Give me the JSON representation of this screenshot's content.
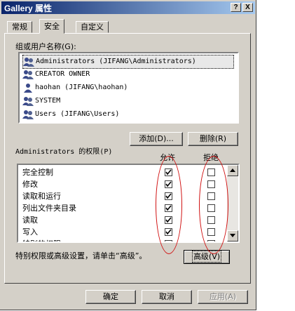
{
  "window": {
    "title": "Gallery 属性",
    "help_label": "?",
    "close_label": "X"
  },
  "tabs": [
    {
      "label": "常规",
      "active": false
    },
    {
      "label": "安全",
      "active": true
    },
    {
      "label": "自定义",
      "active": false
    }
  ],
  "users": {
    "label": "组或用户名称(G):",
    "items": [
      "Administrators (JIFANG\\Administrators)",
      "CREATOR OWNER",
      "haohan (JIFANG\\haohan)",
      "SYSTEM",
      "Users (JIFANG\\Users)"
    ],
    "add_label": "添加(D)...",
    "remove_label": "删除(R)"
  },
  "permissions": {
    "label": "Administrators 的权限(P)",
    "allow_header": "允许",
    "deny_header": "拒绝",
    "rows": [
      {
        "name": "完全控制",
        "allow": true,
        "deny": false
      },
      {
        "name": "修改",
        "allow": true,
        "deny": false
      },
      {
        "name": "读取和运行",
        "allow": true,
        "deny": false
      },
      {
        "name": "列出文件夹目录",
        "allow": true,
        "deny": false
      },
      {
        "name": "读取",
        "allow": true,
        "deny": false
      },
      {
        "name": "写入",
        "allow": true,
        "deny": false
      },
      {
        "name": "特别的权限",
        "allow": false,
        "deny": false
      }
    ]
  },
  "advanced": {
    "note": "特别权限或高级设置，请单击“高级”。",
    "button_label": "高级(V)"
  },
  "footer": {
    "ok_label": "确定",
    "cancel_label": "取消",
    "apply_label": "应用(A)"
  },
  "colors": {
    "annotation": "#d01010",
    "titlebar": "#0a246a",
    "face": "#d4d0c8"
  }
}
